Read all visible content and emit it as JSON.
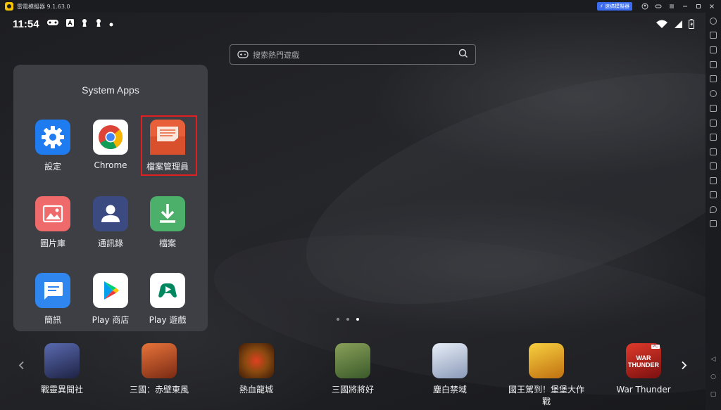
{
  "titlebar": {
    "title": "雷電模擬器 9.1.63.0",
    "speed_button": "⚡ 速搞模擬器"
  },
  "status_bar": {
    "time": "11:54"
  },
  "search": {
    "placeholder": "搜索熱門遊戲"
  },
  "folder": {
    "title": "System Apps",
    "apps": [
      {
        "label": "設定",
        "icon": "gear-icon"
      },
      {
        "label": "Chrome",
        "icon": "chrome-icon"
      },
      {
        "label": "檔案管理員",
        "icon": "file-manager-icon"
      },
      {
        "label": "圖片庫",
        "icon": "gallery-icon"
      },
      {
        "label": "通訊錄",
        "icon": "contacts-icon"
      },
      {
        "label": "檔案",
        "icon": "download-icon"
      },
      {
        "label": "簡訊",
        "icon": "messages-icon"
      },
      {
        "label": "Play 商店",
        "icon": "play-store-icon"
      },
      {
        "label": "Play 遊戲",
        "icon": "play-games-icon"
      }
    ]
  },
  "dock": {
    "games": [
      {
        "label": "戰靈異聞社",
        "color": "#3a3f70"
      },
      {
        "label": "三國：赤壁東風",
        "color": "#c0502a"
      },
      {
        "label": "熱血龍城",
        "color": "#7a3a1a"
      },
      {
        "label": "三國將將好",
        "color": "#5a7a3a"
      },
      {
        "label": "塵白禁域",
        "color": "#b8c4d8"
      },
      {
        "label": "國王駕到！堡堡大作戰",
        "color": "#e0a020"
      },
      {
        "label": "War Thunder",
        "color": "#b02020"
      }
    ],
    "war_thunder_logo": "WAR THUNDER",
    "war_thunder_badge": "PC"
  },
  "colors": {
    "accent": "#3b6cf0",
    "highlight": "#e02020"
  }
}
